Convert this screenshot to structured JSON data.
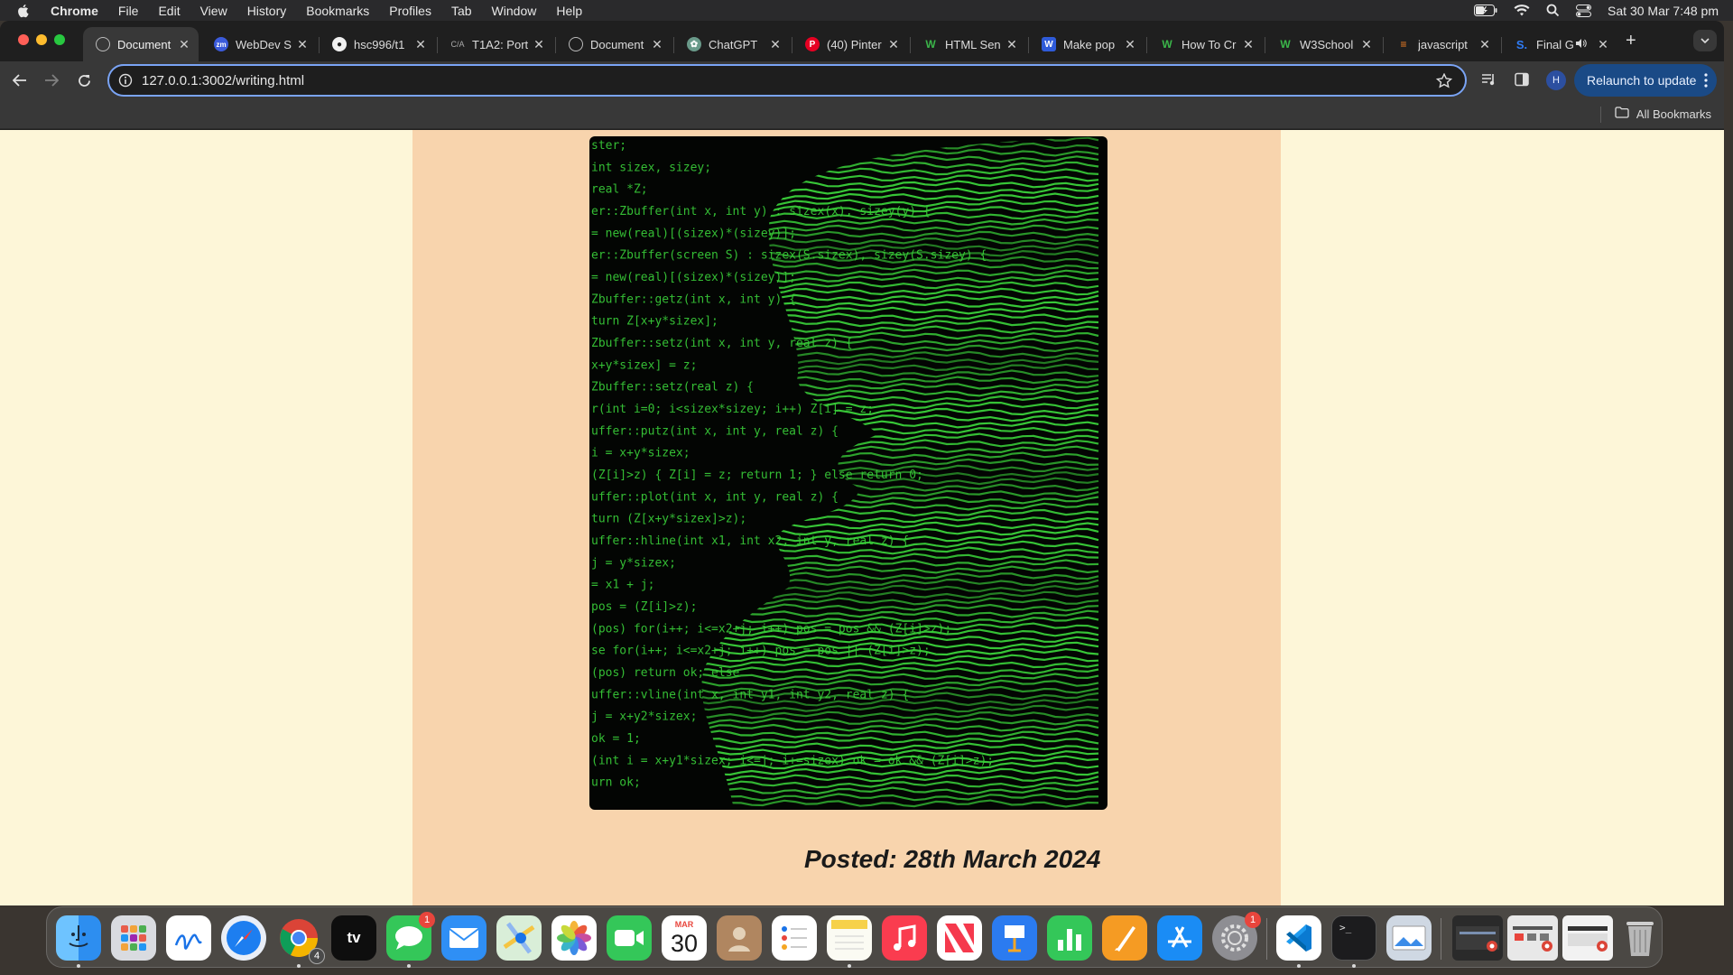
{
  "menubar": {
    "app_name": "Chrome",
    "items": [
      "File",
      "Edit",
      "View",
      "History",
      "Bookmarks",
      "Profiles",
      "Tab",
      "Window",
      "Help"
    ],
    "clock": "Sat 30 Mar  7:48 pm"
  },
  "tabs": [
    {
      "title": "Document",
      "active": true
    },
    {
      "title": "WebDev S",
      "active": false
    },
    {
      "title": "hsc996/t1",
      "active": false
    },
    {
      "title": "T1A2: Port",
      "active": false
    },
    {
      "title": "Document",
      "active": false
    },
    {
      "title": "ChatGPT",
      "active": false
    },
    {
      "title": "(40) Pinter",
      "active": false
    },
    {
      "title": "HTML Sen",
      "active": false
    },
    {
      "title": "Make pop",
      "active": false
    },
    {
      "title": "How To Cr",
      "active": false
    },
    {
      "title": "W3School",
      "active": false
    },
    {
      "title": "javascript",
      "active": false
    },
    {
      "title": "Final G",
      "active": false
    }
  ],
  "toolbar": {
    "url": "127.0.0.1:3002/writing.html",
    "profile_initial": "H",
    "relaunch_label": "Relaunch to update"
  },
  "bookmarks_bar": {
    "all_bookmarks_label": "All Bookmarks"
  },
  "page": {
    "image_code_lines": [
      "ster;",
      "int sizex, sizey;",
      "real *Z;",
      "er::Zbuffer(int x, int y) : sizex(x), sizey(y) {",
      "= new(real)[(sizex)*(sizey)];",
      "er::Zbuffer(screen S) : sizex(S.sizex), sizey(S.sizey) {",
      "= new(real)[(sizex)*(sizey)];",
      "Zbuffer::getz(int x, int y) {",
      "turn Z[x+y*sizex];",
      "Zbuffer::setz(int x, int y, real z) {",
      "x+y*sizex] = z;",
      "Zbuffer::setz(real z) {",
      "r(int i=0; i<sizex*sizey; i++) Z[i] = z;",
      "uffer::putz(int x, int y, real z) {",
      "i = x+y*sizex;",
      "(Z[i]>z) { Z[i] = z; return 1; } else return 0;",
      "uffer::plot(int x, int y, real z) {",
      "turn (Z[x+y*sizex]>z);",
      "uffer::hline(int x1, int x2, int y, real z) {",
      "j = y*sizex;",
      "= x1 + j;",
      "pos = (Z[i]>z);",
      "(pos) for(i++; i<=x2+j; i++) pos = pos && (Z[i]>z);",
      "se for(i++; i<=x2+j; i++) pos = pos || (Z[i]>z);",
      "(pos) return ok; else",
      "uffer::vline(int x, int y1, int y2, real z) {",
      "j = x+y2*sizex;",
      "ok = 1;",
      "(int i = x+y1*sizex; i<=j; i+=sizex) ok = ok && (Z[i]>z);",
      "urn ok;"
    ],
    "posted": "Posted: 28th March 2024"
  },
  "dock": {
    "apps": [
      {
        "name": "Finder",
        "running": true
      },
      {
        "name": "Launchpad",
        "running": false
      },
      {
        "name": "Freeform",
        "running": false
      },
      {
        "name": "Safari",
        "running": false
      },
      {
        "name": "Chrome",
        "running": true,
        "badge": "4"
      },
      {
        "name": "TV",
        "running": false
      },
      {
        "name": "Messages",
        "running": true,
        "badge": "1"
      },
      {
        "name": "Mail",
        "running": false
      },
      {
        "name": "Maps",
        "running": false
      },
      {
        "name": "Photos",
        "running": false
      },
      {
        "name": "FaceTime",
        "running": false
      },
      {
        "name": "Calendar",
        "running": false,
        "month": "MAR",
        "day": "30"
      },
      {
        "name": "Contacts",
        "running": false
      },
      {
        "name": "Reminders",
        "running": false
      },
      {
        "name": "Notes",
        "running": true
      },
      {
        "name": "Music",
        "running": false
      },
      {
        "name": "News",
        "running": false
      },
      {
        "name": "Keynote",
        "running": false
      },
      {
        "name": "Numbers",
        "running": false
      },
      {
        "name": "Pages",
        "running": false
      },
      {
        "name": "App Store",
        "running": false
      },
      {
        "name": "System Settings",
        "running": false,
        "badge": "1"
      },
      {
        "name": "VS Code",
        "running": true
      },
      {
        "name": "Terminal",
        "running": true
      },
      {
        "name": "Preview",
        "running": false
      }
    ]
  },
  "colors": {
    "page_background": "#fdf6d8",
    "content_column": "#f8d4ad",
    "code_green": "#3ad13a",
    "omnibox_focus": "#7aa4f5",
    "relaunch_button": "#1a4a86"
  }
}
